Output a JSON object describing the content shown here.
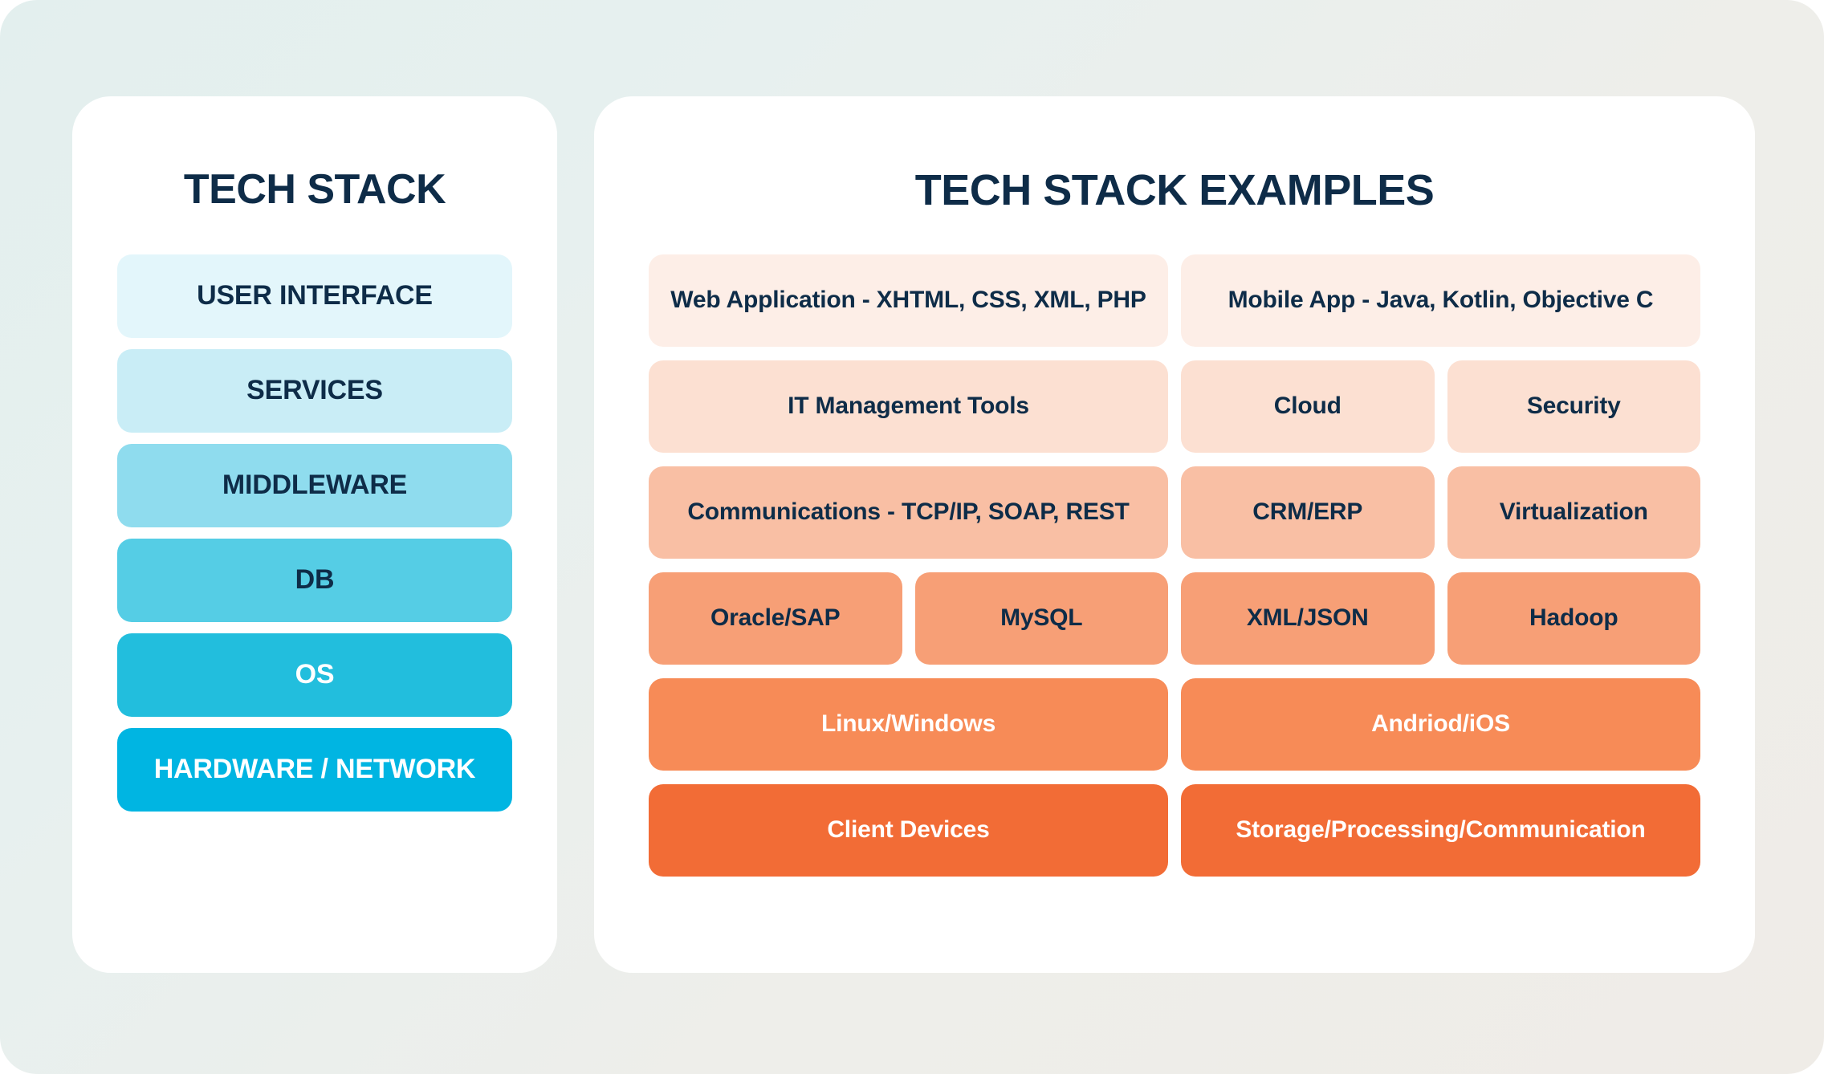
{
  "background": {
    "gradient_from": "#e3efee",
    "gradient_to": "#efece7"
  },
  "left_panel": {
    "title": "TECH STACK",
    "layers": [
      {
        "label": "USER INTERFACE",
        "color": "#e3f6fb",
        "text_color": "#0e2c48"
      },
      {
        "label": "SERVICES",
        "color": "#c9edf6",
        "text_color": "#0e2c48"
      },
      {
        "label": "MIDDLEWARE",
        "color": "#8fdcee",
        "text_color": "#0e2c48"
      },
      {
        "label": "DB",
        "color": "#55cde5",
        "text_color": "#0e2c48"
      },
      {
        "label": "OS",
        "color": "#22bedd",
        "text_color": "#ffffff"
      },
      {
        "label": "HARDWARE / NETWORK",
        "color": "#00b5e2",
        "text_color": "#ffffff"
      }
    ]
  },
  "right_panel": {
    "title": "TECH STACK EXAMPLES",
    "rows": [
      {
        "row_color": "#fdeee7",
        "text_color": "#0e2c48",
        "cells": [
          {
            "label": "Web Application - XHTML, CSS, XML, PHP",
            "span": 2
          },
          {
            "label": "Mobile App - Java, Kotlin, Objective C",
            "span": 2
          }
        ]
      },
      {
        "row_color": "#fce0d2",
        "text_color": "#0e2c48",
        "cells": [
          {
            "label": "IT Management Tools",
            "span": 2
          },
          {
            "label": "Cloud",
            "span": 1
          },
          {
            "label": "Security",
            "span": 1
          }
        ]
      },
      {
        "row_color": "#f9bfa4",
        "text_color": "#0e2c48",
        "cells": [
          {
            "label": "Communications - TCP/IP, SOAP, REST",
            "span": 2
          },
          {
            "label": "CRM/ERP",
            "span": 1
          },
          {
            "label": "Virtualization",
            "span": 1
          }
        ]
      },
      {
        "row_color": "#f79f76",
        "text_color": "#0e2c48",
        "cells": [
          {
            "label": "Oracle/SAP",
            "span": 1
          },
          {
            "label": "MySQL",
            "span": 1
          },
          {
            "label": "XML/JSON",
            "span": 1
          },
          {
            "label": "Hadoop",
            "span": 1
          }
        ]
      },
      {
        "row_color": "#f78b57",
        "text_color": "#ffffff",
        "cells": [
          {
            "label": "Linux/Windows",
            "span": 2
          },
          {
            "label": "Andriod/iOS",
            "span": 2
          }
        ]
      },
      {
        "row_color": "#f26c36",
        "text_color": "#ffffff",
        "cells": [
          {
            "label": "Client Devices",
            "span": 2
          },
          {
            "label": "Storage/Processing/Communication",
            "span": 2
          }
        ]
      }
    ]
  }
}
